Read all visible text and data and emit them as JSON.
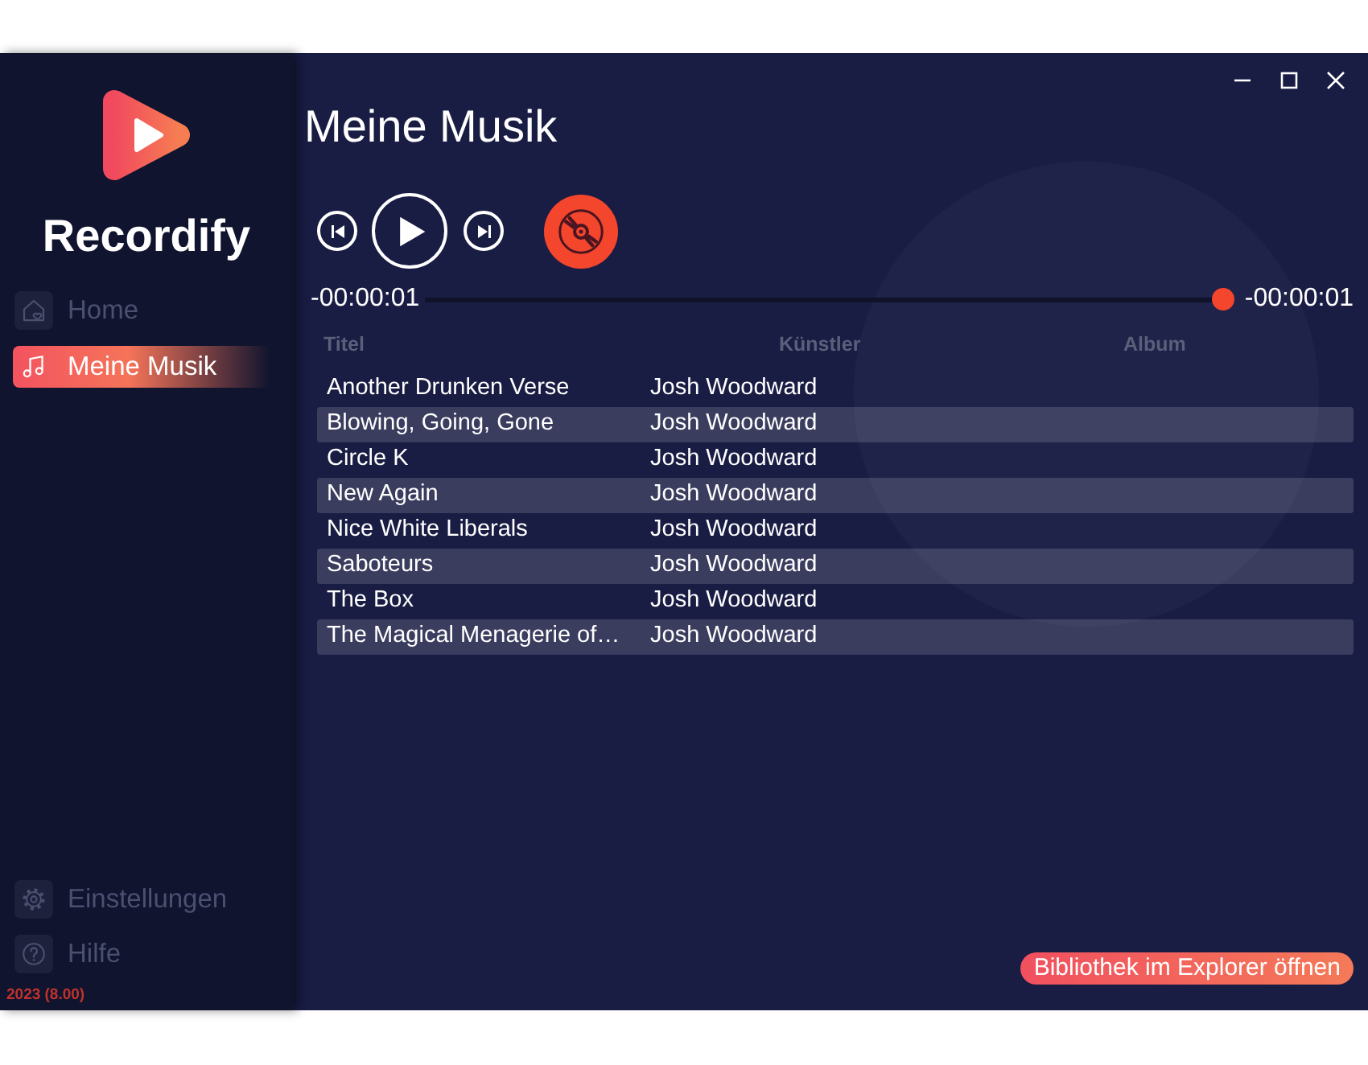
{
  "sidebar": {
    "app_name": "Recordify",
    "nav": [
      {
        "label": "Home",
        "selected": false
      },
      {
        "label": "Meine Musik",
        "selected": true
      }
    ],
    "bottom_nav": [
      {
        "label": "Einstellungen",
        "selected": false
      },
      {
        "label": "Hilfe",
        "selected": false
      }
    ],
    "version": "2023 (8.00)"
  },
  "page": {
    "title": "Meine Musik"
  },
  "player": {
    "elapsed": "-00:00:01",
    "remaining": "-00:00:01",
    "level": 1
  },
  "table": {
    "columns": [
      "Titel",
      "Künstler",
      "Album"
    ],
    "rows": [
      {
        "title": "Another Drunken Verse",
        "artist": "Josh Woodward"
      },
      {
        "title": "Blowing, Going, Gone",
        "artist": "Josh Woodward"
      },
      {
        "title": "Circle K",
        "artist": "Josh Woodward"
      },
      {
        "title": "New Again",
        "artist": "Josh Woodward"
      },
      {
        "title": "Nice White Liberals",
        "artist": "Josh Woodward"
      },
      {
        "title": "Saboteurs",
        "artist": "Josh Woodward"
      },
      {
        "title": "The Box",
        "artist": "Josh Woodward"
      },
      {
        "title": "The Magical Menagerie of…",
        "artist": "Josh Woodward"
      }
    ]
  },
  "footer": {
    "button": "Bibliothek im Explorer öffnen"
  }
}
